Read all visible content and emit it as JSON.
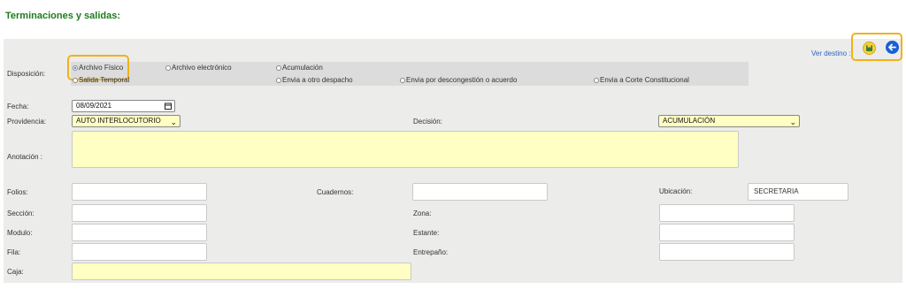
{
  "title": "Terminaciones y salidas:",
  "ver_destino": "Ver destino :",
  "disposicion": {
    "label": "Disposición:",
    "options": [
      "Archivo Físico",
      "Archivo electrónico",
      "Acumulación",
      "Salida Temporal",
      "Envia a otro despacho",
      "Envia por descongestión o acuerdo",
      "Envia a Corte Constitucional"
    ],
    "selected": "Archivo Físico"
  },
  "fecha": {
    "label": "Fecha:",
    "value": "08/09/2021"
  },
  "providencia": {
    "label": "Providencia:",
    "value": "AUTO INTERLOCUTORIO"
  },
  "decision": {
    "label": "Decisión:",
    "value": "ACUMULACIÓN"
  },
  "anotacion": {
    "label": "Anotación :",
    "value": ""
  },
  "folios": {
    "label": "Folios:",
    "value": ""
  },
  "cuadernos": {
    "label": "Cuadernos:",
    "value": ""
  },
  "ubicacion": {
    "label": "Ubicación:",
    "value": "SECRETARIA"
  },
  "seccion": {
    "label": "Sección:",
    "value": ""
  },
  "zona": {
    "label": "Zona:",
    "value": ""
  },
  "modulo": {
    "label": "Modulo:",
    "value": ""
  },
  "estante": {
    "label": "Estante:",
    "value": ""
  },
  "fila": {
    "label": "Fila:",
    "value": ""
  },
  "entrepano": {
    "label": "Entrepaño:",
    "value": ""
  },
  "caja": {
    "label": "Caja:",
    "value": ""
  },
  "colors": {
    "title": "#1e7b1e",
    "highlight": "#f0b21a",
    "save_icon": "#3a7d3a",
    "back_icon": "#1a5fd6",
    "yellow_field": "#ffffc4"
  },
  "icons": {
    "save": "save-icon",
    "back": "back-arrow-icon",
    "calendar": "calendar-icon",
    "chevron": "chevron-down-icon"
  }
}
